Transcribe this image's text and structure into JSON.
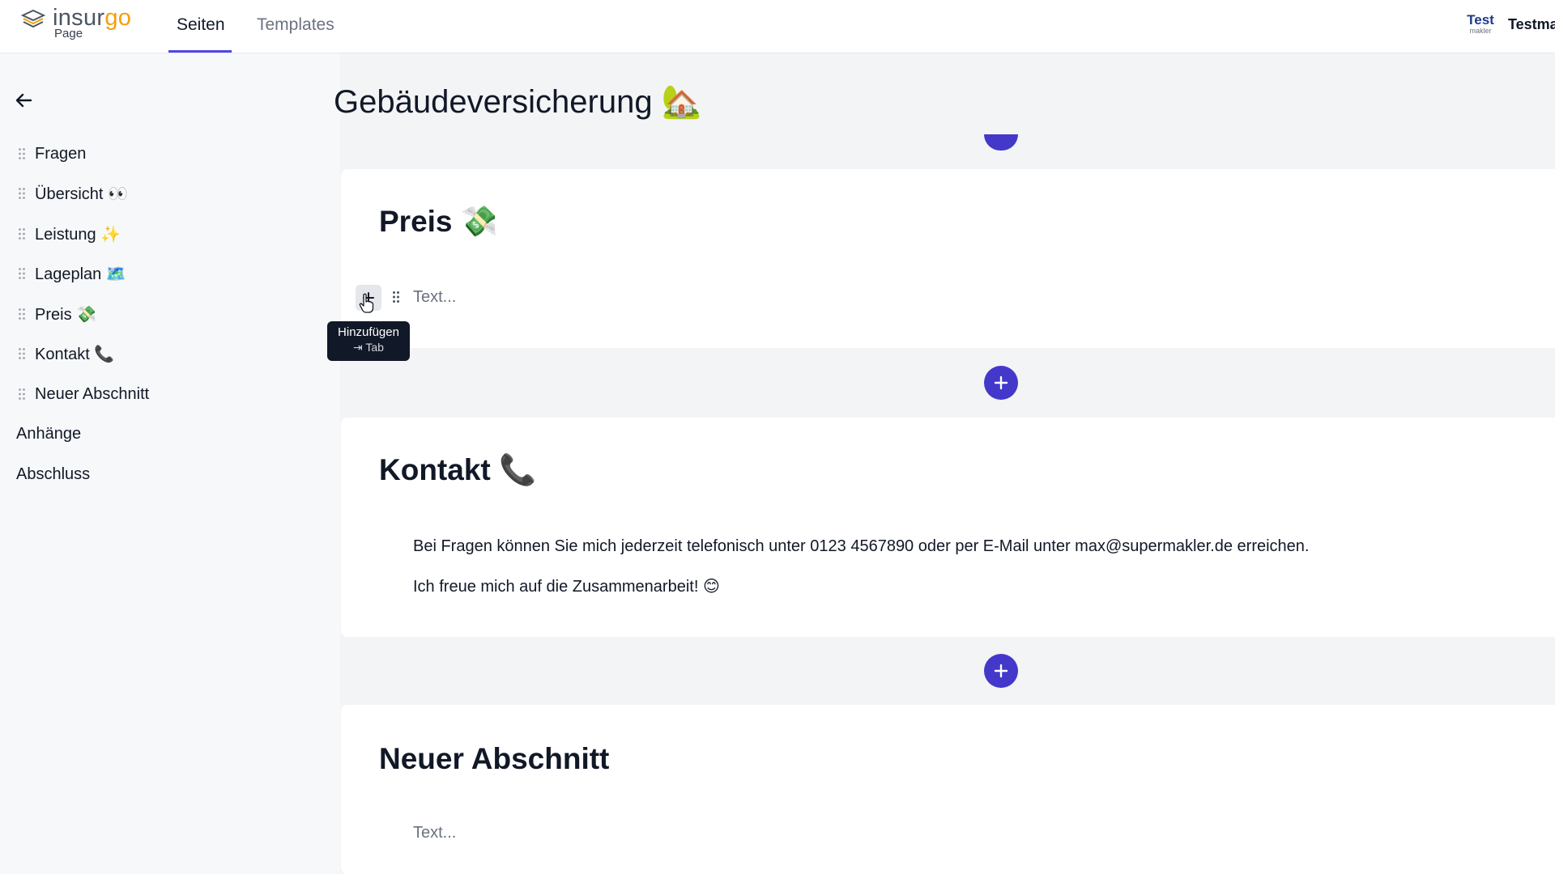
{
  "header": {
    "logo_word_a": "insur",
    "logo_word_b": "go",
    "logo_sub": "Page",
    "tabs": [
      {
        "label": "Seiten",
        "active": true
      },
      {
        "label": "Templates",
        "active": false
      }
    ],
    "brand_top": "Test",
    "brand_bottom": "makler",
    "account_name": "Testmakler",
    "accent_color": "#4f46e5"
  },
  "sidebar": {
    "items": [
      {
        "label": "Fragen"
      },
      {
        "label": "Übersicht 👀"
      },
      {
        "label": "Leistung ✨"
      },
      {
        "label": "Lageplan 🗺️"
      },
      {
        "label": "Preis 💸"
      },
      {
        "label": "Kontakt 📞"
      },
      {
        "label": "Neuer Abschnitt"
      }
    ],
    "extra": [
      {
        "label": "Anhänge"
      },
      {
        "label": "Abschluss"
      }
    ]
  },
  "main": {
    "page_title": "Gebäudeversicherung 🏡",
    "sections": [
      {
        "title": "Preis 💸",
        "placeholder": "Text..."
      },
      {
        "title": "Kontakt 📞",
        "paragraphs": [
          "Bei Fragen können Sie mich jederzeit telefonisch unter 0123 4567890 oder per E-Mail unter max@supermakler.de erreichen.",
          "Ich freue mich auf die Zusammenarbeit! 😊"
        ]
      },
      {
        "title": "Neuer Abschnitt",
        "placeholder": "Text..."
      }
    ],
    "tooltip": {
      "title": "Hinzufügen",
      "shortcut": "⇥ Tab"
    },
    "add_button_color": "#4338ca"
  }
}
